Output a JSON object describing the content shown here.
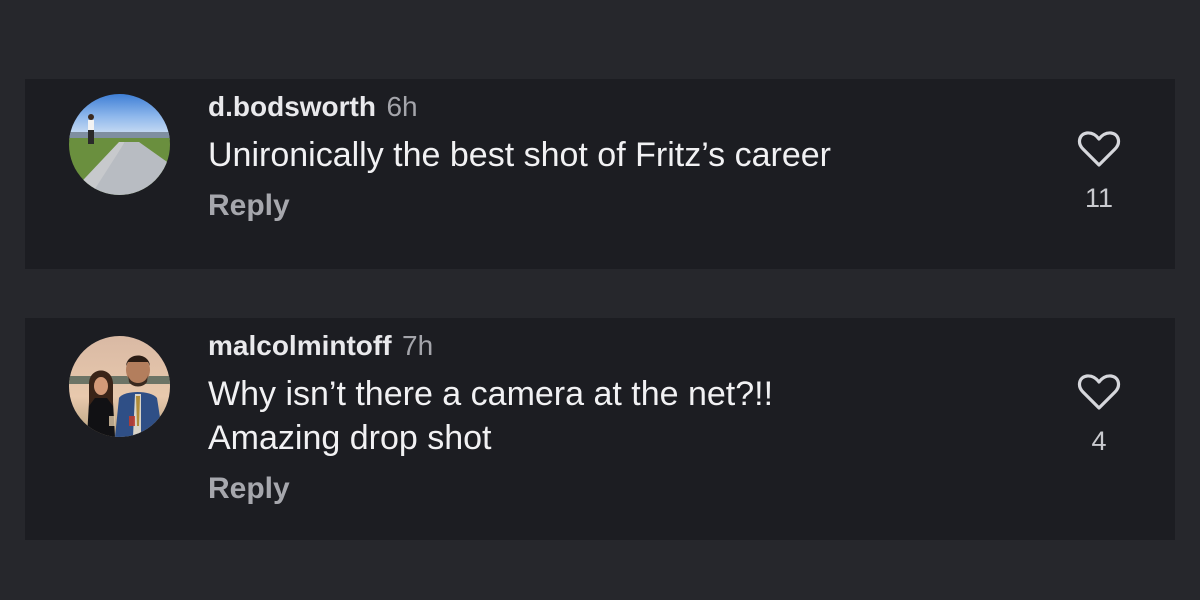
{
  "comments": [
    {
      "username": "d.bodsworth",
      "time": "6h",
      "text": "Unironically the best shot of Fritz’s career",
      "reply_label": "Reply",
      "likes": "11",
      "like_icon": "heart-outline-icon"
    },
    {
      "username": "malcolmintoff",
      "time": "7h",
      "text_lines": [
        "Why isn’t there a camera at the net?!!",
        "Amazing drop shot"
      ],
      "reply_label": "Reply",
      "likes": "4",
      "like_icon": "heart-outline-icon"
    }
  ],
  "colors": {
    "page_background": "#26272c",
    "comment_background": "#1c1d22",
    "primary_text": "#f1f1f3",
    "secondary_text": "#a4a5ab"
  }
}
